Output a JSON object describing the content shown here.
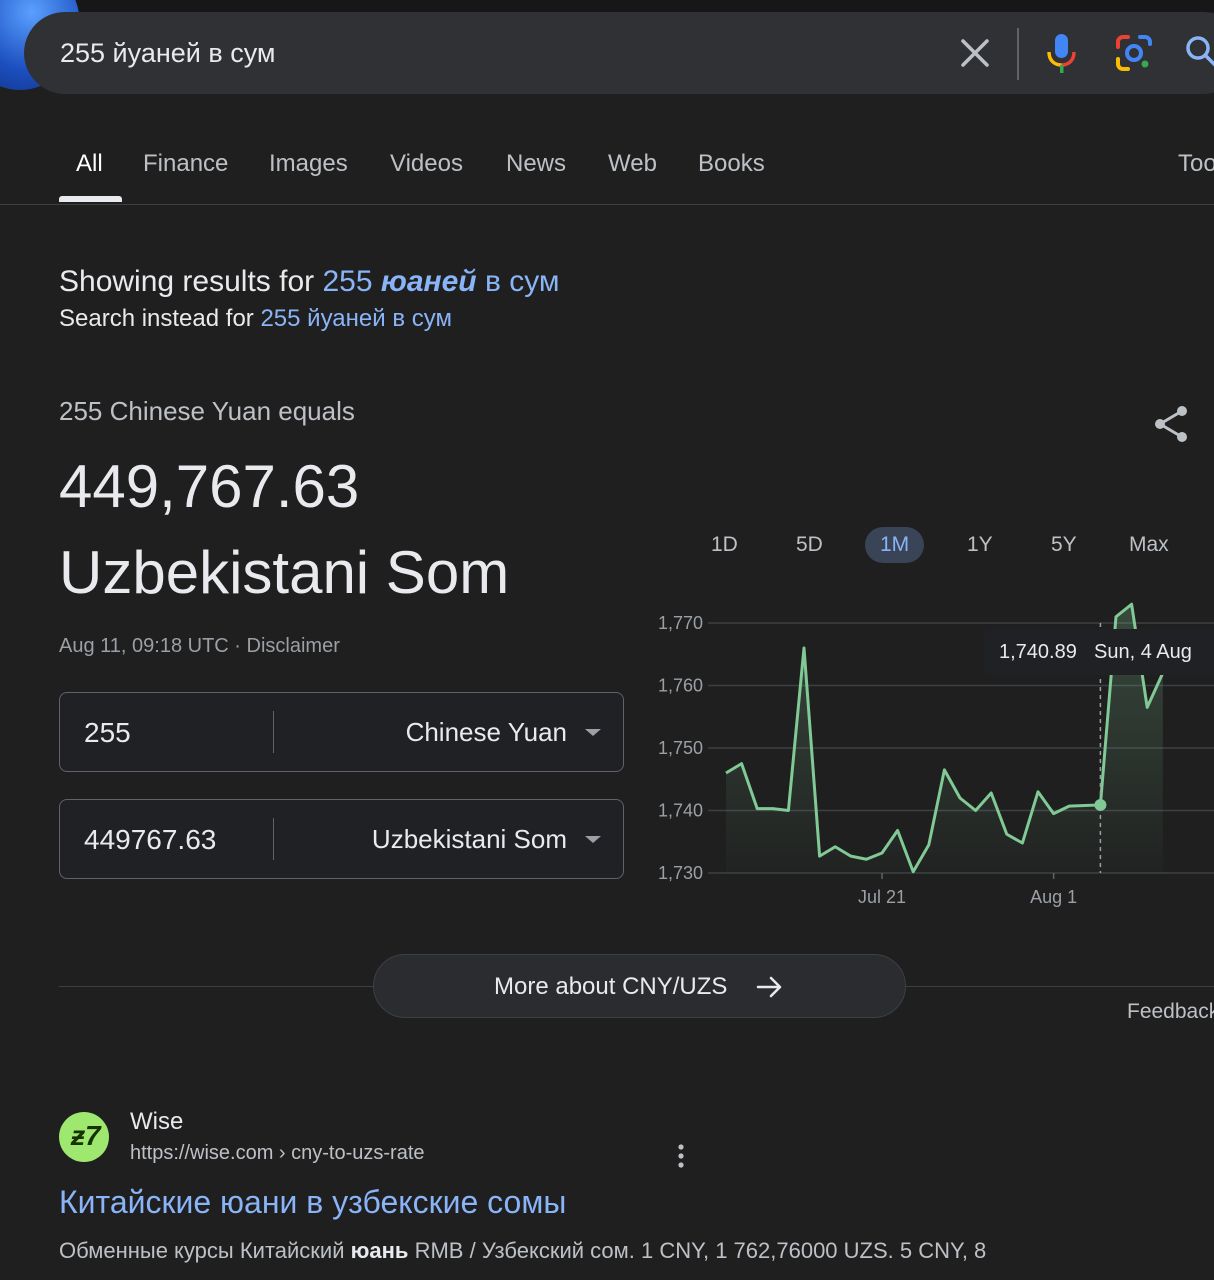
{
  "search": {
    "query": "255 йуаней в сум"
  },
  "tabs": [
    {
      "label": "All"
    },
    {
      "label": "Finance"
    },
    {
      "label": "Images"
    },
    {
      "label": "Videos"
    },
    {
      "label": "News"
    },
    {
      "label": "Web"
    },
    {
      "label": "Books"
    },
    {
      "label": "Too"
    }
  ],
  "correction": {
    "showing_prefix": "Showing results for",
    "corrected_num": "255",
    "corrected_word": "юаней",
    "corrected_rest": "в сум",
    "instead_prefix": "Search instead for",
    "original_query": "255 йуаней в сум"
  },
  "converter": {
    "equals_text": "255 Chinese Yuan equals",
    "result_value": "449,767.63",
    "result_currency": "Uzbekistani Som",
    "timestamp": "Aug 11, 09:18 UTC",
    "separator": "·",
    "disclaimer": "Disclaimer",
    "from": {
      "amount": "255",
      "currency": "Chinese Yuan"
    },
    "to": {
      "amount": "449767.63",
      "currency": "Uzbekistani Som"
    }
  },
  "ranges": [
    "1D",
    "5D",
    "1M",
    "1Y",
    "5Y",
    "Max"
  ],
  "active_range": "1M",
  "tooltip": {
    "value": "1,740.89",
    "date": "Sun, 4 Aug"
  },
  "chart_data": {
    "type": "line",
    "x": [
      "Jul 11",
      "Jul 12",
      "Jul 13",
      "Jul 14",
      "Jul 15",
      "Jul 16",
      "Jul 17",
      "Jul 18",
      "Jul 19",
      "Jul 20",
      "Jul 21",
      "Jul 22",
      "Jul 23",
      "Jul 24",
      "Jul 25",
      "Jul 26",
      "Jul 27",
      "Jul 28",
      "Jul 29",
      "Jul 30",
      "Jul 31",
      "Aug 1",
      "Aug 2",
      "Aug 3",
      "Aug 4",
      "Aug 5",
      "Aug 6",
      "Aug 7",
      "Aug 8"
    ],
    "series": [
      {
        "values": [
          1746,
          1747.5,
          1740.3,
          1740.3,
          1740,
          1766,
          1732.7,
          1734.2,
          1732.7,
          1732.2,
          1733.2,
          1736.8,
          1730.2,
          1734.5,
          1746.5,
          1742,
          1740,
          1742.8,
          1736.2,
          1734.8,
          1743,
          1739.5,
          1740.7,
          1740.8,
          1740.89,
          1771,
          1773,
          1756.5,
          1762
        ],
        "color": "#81c995"
      }
    ],
    "y_ticks": [
      "1,730",
      "1,740",
      "1,750",
      "1,760",
      "1,770"
    ],
    "x_ticks": [
      "Jul 21",
      "Aug 1"
    ],
    "ylim": [
      1730,
      1770
    ],
    "grid": true,
    "highlight_index": 24
  },
  "more_button": {
    "label": "More about CNY/UZS"
  },
  "feedback": "Feedback",
  "result": {
    "logo_text": "ƶ7",
    "site_name": "Wise",
    "url": "https://wise.com › cny-to-uzs-rate",
    "title": "Китайские юани в узбекские сомы",
    "snippet_a": "Обменные курсы Китайский",
    "snippet_b": "юань",
    "snippet_c": "RMB / Узбекский сом. 1 CNY, 1 762,76000 UZS. 5 CNY, 8"
  }
}
